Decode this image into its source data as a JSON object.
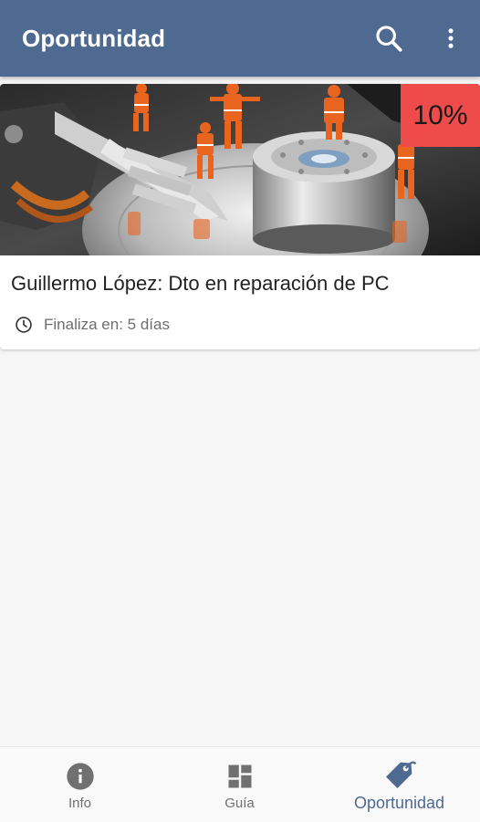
{
  "appbar": {
    "title": "Oportunidad",
    "search_icon": "search-icon",
    "more_icon": "more-vert-icon",
    "color": "#4f6a91"
  },
  "offers": [
    {
      "title": "Guillermo López: Dto en reparación de PC",
      "discount": "10%",
      "ends_label": "Finaliza en: 5 días",
      "image": "hard-drive-repair-workers-photo",
      "badge_color": "#f04b4b"
    }
  ],
  "bottom_nav": {
    "items": [
      {
        "label": "Info",
        "icon": "info-icon",
        "active": false
      },
      {
        "label": "Guía",
        "icon": "dashboard-icon",
        "active": false
      },
      {
        "label": "Oportunidad",
        "icon": "tag-icon",
        "active": true
      }
    ],
    "active_color": "#4f6a91",
    "inactive_color": "#707070"
  }
}
